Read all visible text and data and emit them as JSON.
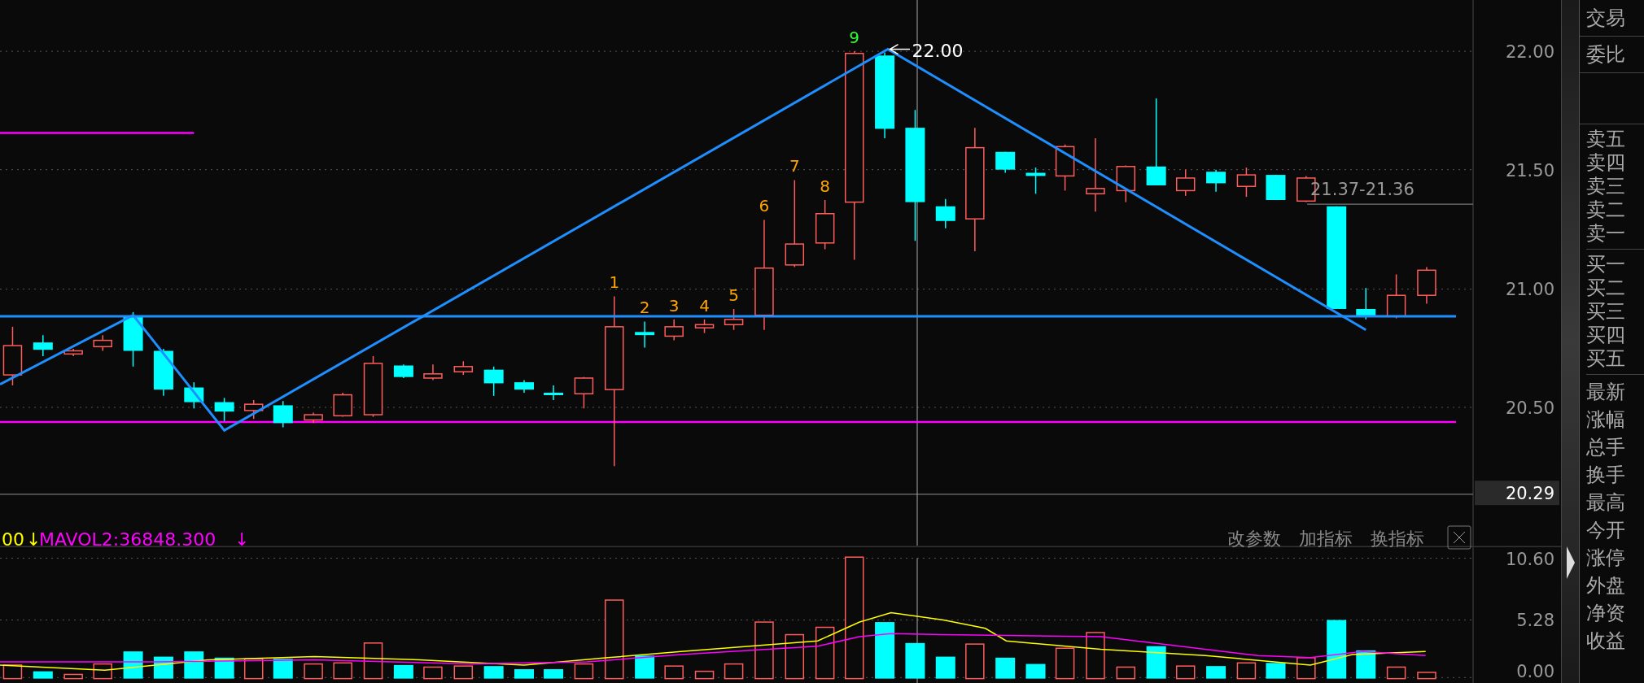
{
  "price_chart": {
    "counts": [
      {
        "text": "1",
        "kind": "setup"
      },
      {
        "text": "2",
        "kind": "setup"
      },
      {
        "text": "3",
        "kind": "setup"
      },
      {
        "text": "4",
        "kind": "setup"
      },
      {
        "text": "5",
        "kind": "setup"
      },
      {
        "text": "6",
        "kind": "setup"
      },
      {
        "text": "7",
        "kind": "setup"
      },
      {
        "text": "8",
        "kind": "setup"
      },
      {
        "text": "9",
        "kind": "complete"
      }
    ],
    "pivot_label": "22.00",
    "range_label": "21.37-21.36",
    "axis": {
      "ticks": [
        "22.00",
        "21.50",
        "21.00",
        "20.50"
      ],
      "current": "20.29"
    }
  },
  "volume_panel": {
    "indicators": [
      {
        "text": "00",
        "arrow": "↓",
        "color": "#ffff00"
      },
      {
        "text": "MAVOL2:36848.300",
        "arrow": "↓",
        "color": "#ff00ff"
      }
    ],
    "buttons": [
      "改参数",
      "加指标",
      "换指标"
    ],
    "axis_ticks": [
      "10.60",
      "5.28",
      "0.00"
    ]
  },
  "quote_panel": {
    "header": [
      "交易",
      "委比"
    ],
    "sell": [
      "卖五",
      "卖四",
      "卖三",
      "卖二",
      "卖一"
    ],
    "buy": [
      "买一",
      "买二",
      "买三",
      "买四",
      "买五"
    ],
    "fields": [
      "最新",
      "涨幅",
      "总手",
      "换手",
      "最高",
      "今开",
      "涨停",
      "外盘",
      "净资",
      "收益"
    ]
  }
}
